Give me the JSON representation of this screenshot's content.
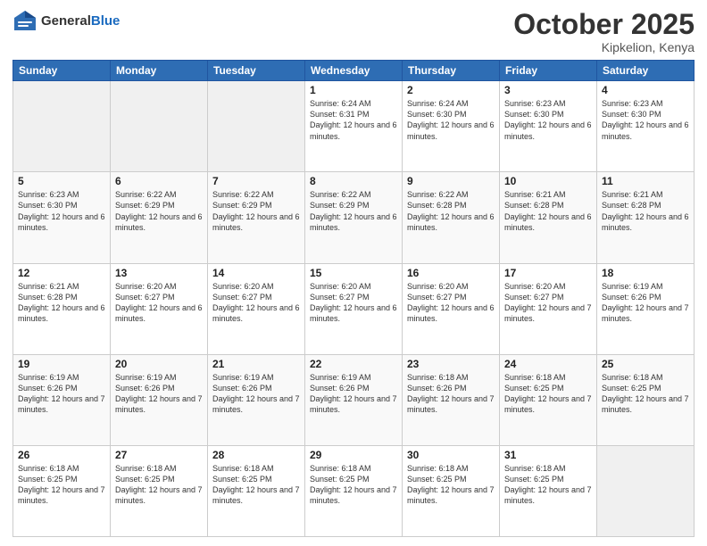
{
  "header": {
    "logo_general": "General",
    "logo_blue": "Blue",
    "month_title": "October 2025",
    "location": "Kipkelion, Kenya"
  },
  "weekdays": [
    "Sunday",
    "Monday",
    "Tuesday",
    "Wednesday",
    "Thursday",
    "Friday",
    "Saturday"
  ],
  "weeks": [
    [
      {
        "day": "",
        "sunrise": "",
        "sunset": "",
        "daylight": ""
      },
      {
        "day": "",
        "sunrise": "",
        "sunset": "",
        "daylight": ""
      },
      {
        "day": "",
        "sunrise": "",
        "sunset": "",
        "daylight": ""
      },
      {
        "day": "1",
        "sunrise": "Sunrise: 6:24 AM",
        "sunset": "Sunset: 6:31 PM",
        "daylight": "Daylight: 12 hours and 6 minutes."
      },
      {
        "day": "2",
        "sunrise": "Sunrise: 6:24 AM",
        "sunset": "Sunset: 6:30 PM",
        "daylight": "Daylight: 12 hours and 6 minutes."
      },
      {
        "day": "3",
        "sunrise": "Sunrise: 6:23 AM",
        "sunset": "Sunset: 6:30 PM",
        "daylight": "Daylight: 12 hours and 6 minutes."
      },
      {
        "day": "4",
        "sunrise": "Sunrise: 6:23 AM",
        "sunset": "Sunset: 6:30 PM",
        "daylight": "Daylight: 12 hours and 6 minutes."
      }
    ],
    [
      {
        "day": "5",
        "sunrise": "Sunrise: 6:23 AM",
        "sunset": "Sunset: 6:30 PM",
        "daylight": "Daylight: 12 hours and 6 minutes."
      },
      {
        "day": "6",
        "sunrise": "Sunrise: 6:22 AM",
        "sunset": "Sunset: 6:29 PM",
        "daylight": "Daylight: 12 hours and 6 minutes."
      },
      {
        "day": "7",
        "sunrise": "Sunrise: 6:22 AM",
        "sunset": "Sunset: 6:29 PM",
        "daylight": "Daylight: 12 hours and 6 minutes."
      },
      {
        "day": "8",
        "sunrise": "Sunrise: 6:22 AM",
        "sunset": "Sunset: 6:29 PM",
        "daylight": "Daylight: 12 hours and 6 minutes."
      },
      {
        "day": "9",
        "sunrise": "Sunrise: 6:22 AM",
        "sunset": "Sunset: 6:28 PM",
        "daylight": "Daylight: 12 hours and 6 minutes."
      },
      {
        "day": "10",
        "sunrise": "Sunrise: 6:21 AM",
        "sunset": "Sunset: 6:28 PM",
        "daylight": "Daylight: 12 hours and 6 minutes."
      },
      {
        "day": "11",
        "sunrise": "Sunrise: 6:21 AM",
        "sunset": "Sunset: 6:28 PM",
        "daylight": "Daylight: 12 hours and 6 minutes."
      }
    ],
    [
      {
        "day": "12",
        "sunrise": "Sunrise: 6:21 AM",
        "sunset": "Sunset: 6:28 PM",
        "daylight": "Daylight: 12 hours and 6 minutes."
      },
      {
        "day": "13",
        "sunrise": "Sunrise: 6:20 AM",
        "sunset": "Sunset: 6:27 PM",
        "daylight": "Daylight: 12 hours and 6 minutes."
      },
      {
        "day": "14",
        "sunrise": "Sunrise: 6:20 AM",
        "sunset": "Sunset: 6:27 PM",
        "daylight": "Daylight: 12 hours and 6 minutes."
      },
      {
        "day": "15",
        "sunrise": "Sunrise: 6:20 AM",
        "sunset": "Sunset: 6:27 PM",
        "daylight": "Daylight: 12 hours and 6 minutes."
      },
      {
        "day": "16",
        "sunrise": "Sunrise: 6:20 AM",
        "sunset": "Sunset: 6:27 PM",
        "daylight": "Daylight: 12 hours and 6 minutes."
      },
      {
        "day": "17",
        "sunrise": "Sunrise: 6:20 AM",
        "sunset": "Sunset: 6:27 PM",
        "daylight": "Daylight: 12 hours and 7 minutes."
      },
      {
        "day": "18",
        "sunrise": "Sunrise: 6:19 AM",
        "sunset": "Sunset: 6:26 PM",
        "daylight": "Daylight: 12 hours and 7 minutes."
      }
    ],
    [
      {
        "day": "19",
        "sunrise": "Sunrise: 6:19 AM",
        "sunset": "Sunset: 6:26 PM",
        "daylight": "Daylight: 12 hours and 7 minutes."
      },
      {
        "day": "20",
        "sunrise": "Sunrise: 6:19 AM",
        "sunset": "Sunset: 6:26 PM",
        "daylight": "Daylight: 12 hours and 7 minutes."
      },
      {
        "day": "21",
        "sunrise": "Sunrise: 6:19 AM",
        "sunset": "Sunset: 6:26 PM",
        "daylight": "Daylight: 12 hours and 7 minutes."
      },
      {
        "day": "22",
        "sunrise": "Sunrise: 6:19 AM",
        "sunset": "Sunset: 6:26 PM",
        "daylight": "Daylight: 12 hours and 7 minutes."
      },
      {
        "day": "23",
        "sunrise": "Sunrise: 6:18 AM",
        "sunset": "Sunset: 6:26 PM",
        "daylight": "Daylight: 12 hours and 7 minutes."
      },
      {
        "day": "24",
        "sunrise": "Sunrise: 6:18 AM",
        "sunset": "Sunset: 6:25 PM",
        "daylight": "Daylight: 12 hours and 7 minutes."
      },
      {
        "day": "25",
        "sunrise": "Sunrise: 6:18 AM",
        "sunset": "Sunset: 6:25 PM",
        "daylight": "Daylight: 12 hours and 7 minutes."
      }
    ],
    [
      {
        "day": "26",
        "sunrise": "Sunrise: 6:18 AM",
        "sunset": "Sunset: 6:25 PM",
        "daylight": "Daylight: 12 hours and 7 minutes."
      },
      {
        "day": "27",
        "sunrise": "Sunrise: 6:18 AM",
        "sunset": "Sunset: 6:25 PM",
        "daylight": "Daylight: 12 hours and 7 minutes."
      },
      {
        "day": "28",
        "sunrise": "Sunrise: 6:18 AM",
        "sunset": "Sunset: 6:25 PM",
        "daylight": "Daylight: 12 hours and 7 minutes."
      },
      {
        "day": "29",
        "sunrise": "Sunrise: 6:18 AM",
        "sunset": "Sunset: 6:25 PM",
        "daylight": "Daylight: 12 hours and 7 minutes."
      },
      {
        "day": "30",
        "sunrise": "Sunrise: 6:18 AM",
        "sunset": "Sunset: 6:25 PM",
        "daylight": "Daylight: 12 hours and 7 minutes."
      },
      {
        "day": "31",
        "sunrise": "Sunrise: 6:18 AM",
        "sunset": "Sunset: 6:25 PM",
        "daylight": "Daylight: 12 hours and 7 minutes."
      },
      {
        "day": "",
        "sunrise": "",
        "sunset": "",
        "daylight": ""
      }
    ]
  ]
}
